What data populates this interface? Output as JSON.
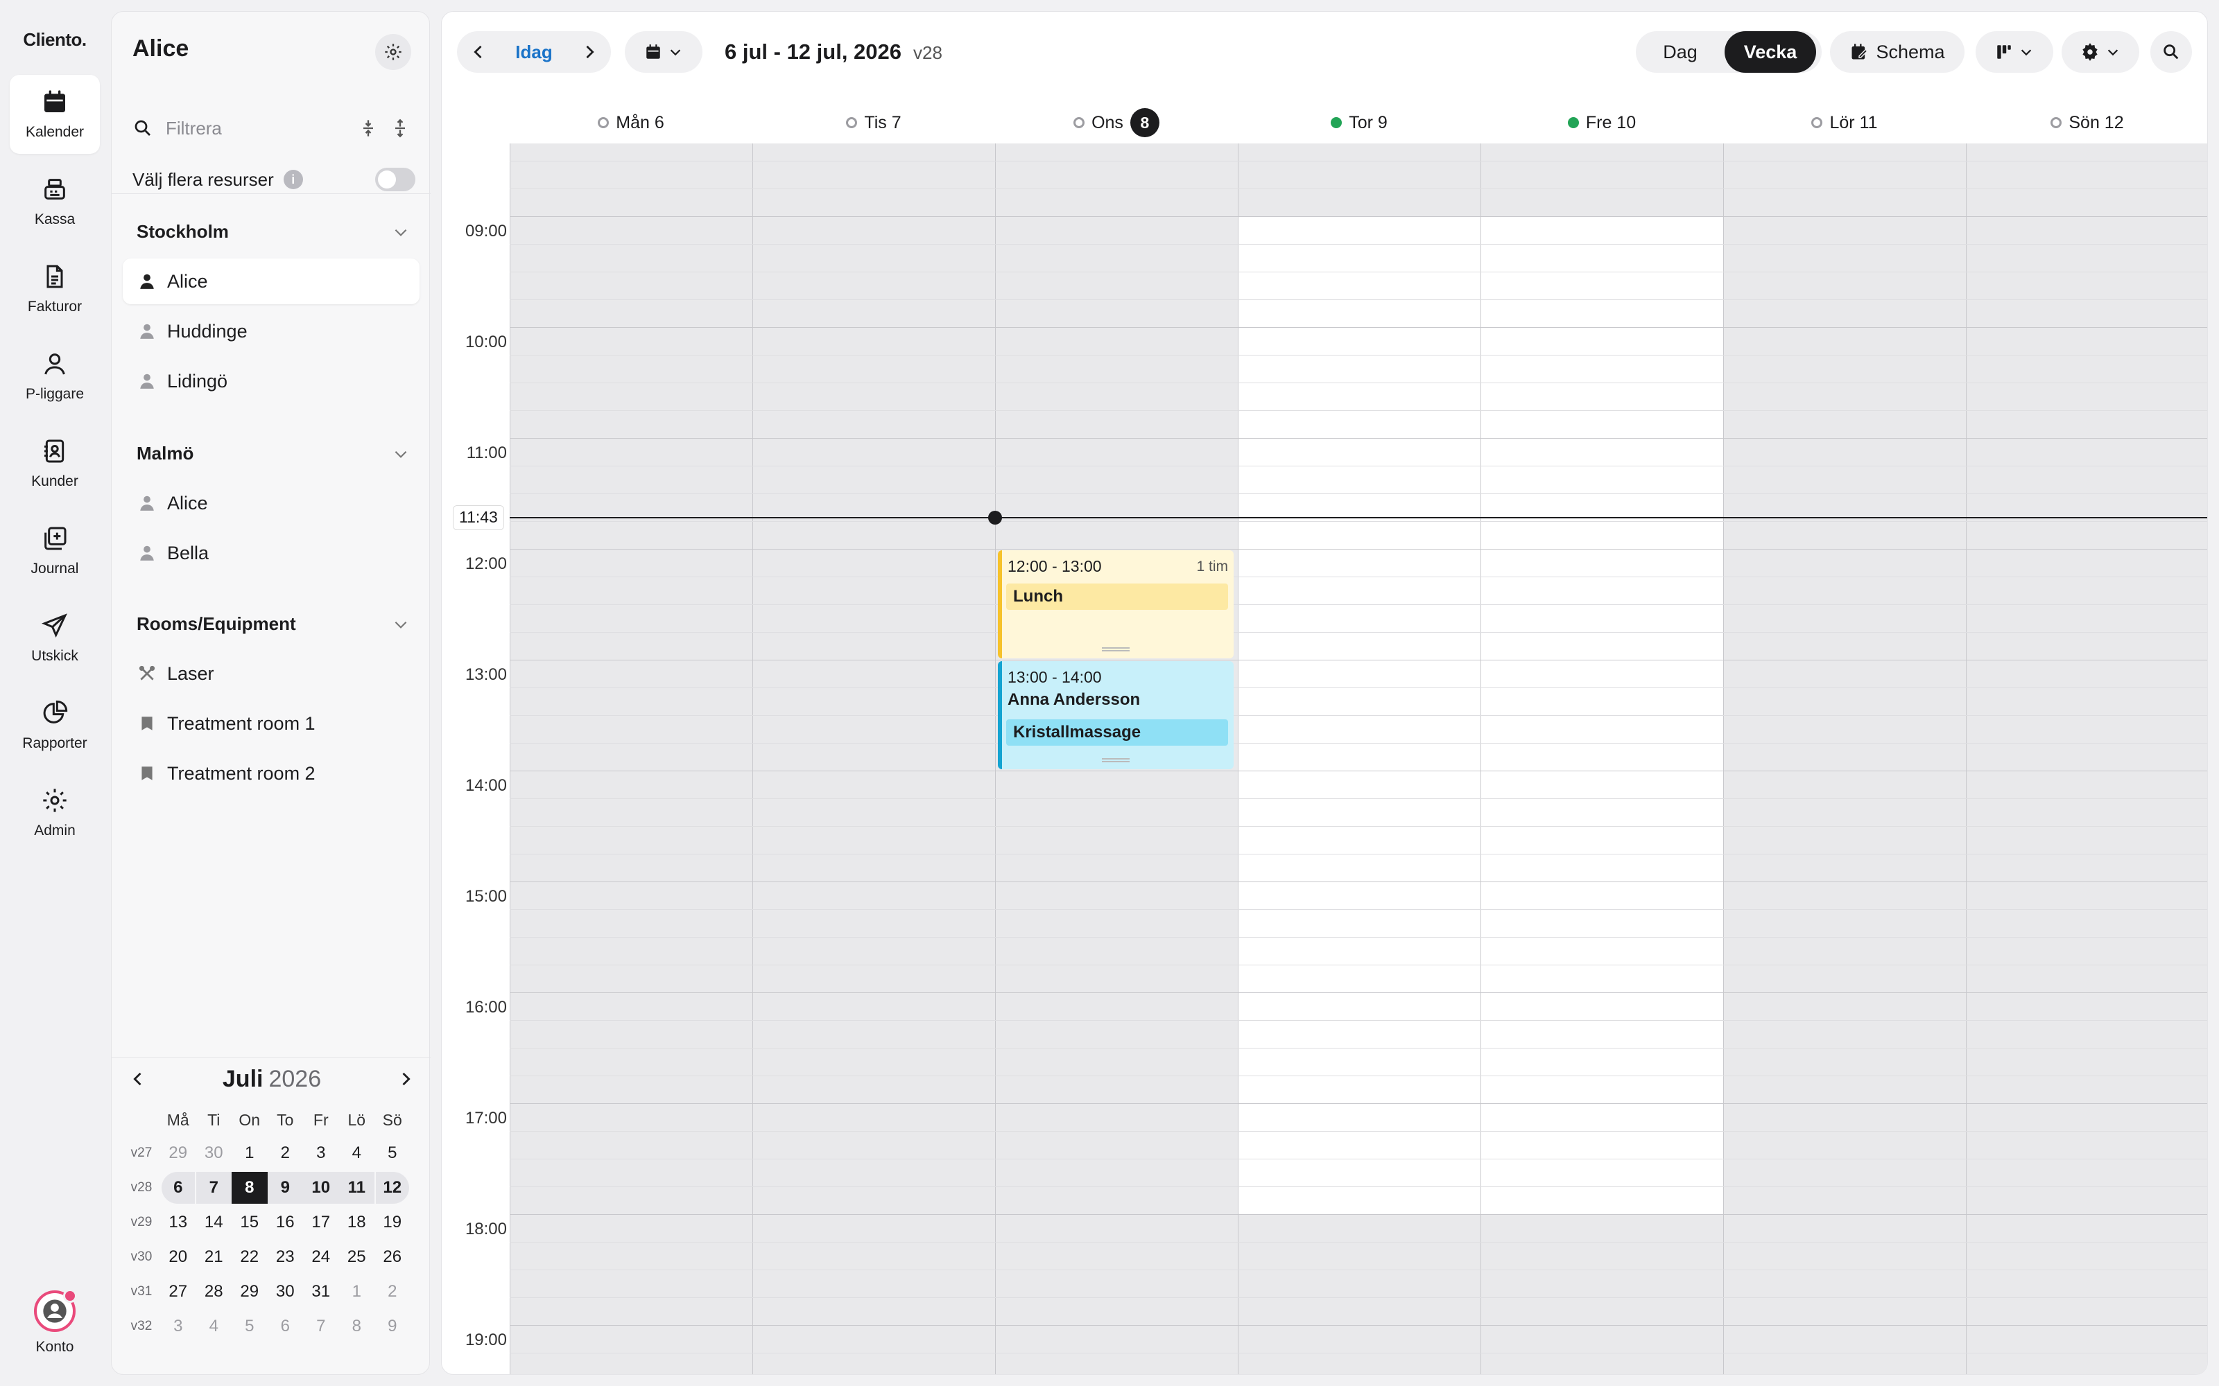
{
  "app": {
    "logo": "Cliento."
  },
  "rail": {
    "items": [
      {
        "label": "Kalender",
        "icon": "calendar-icon",
        "active": true
      },
      {
        "label": "Kassa",
        "icon": "register-icon"
      },
      {
        "label": "Fakturor",
        "icon": "invoice-icon"
      },
      {
        "label": "P-liggare",
        "icon": "person-icon"
      },
      {
        "label": "Kunder",
        "icon": "contacts-icon"
      },
      {
        "label": "Journal",
        "icon": "journal-icon"
      },
      {
        "label": "Utskick",
        "icon": "send-icon"
      },
      {
        "label": "Rapporter",
        "icon": "reports-icon"
      },
      {
        "label": "Admin",
        "icon": "gear-icon"
      }
    ],
    "account_label": "Konto"
  },
  "sidebar": {
    "title": "Alice",
    "filter_placeholder": "Filtrera",
    "multi_label": "Välj flera resurser",
    "groups": [
      {
        "name": "Stockholm",
        "items": [
          {
            "label": "Alice",
            "icon": "person-icon",
            "active": true
          },
          {
            "label": "Huddinge",
            "icon": "person-icon"
          },
          {
            "label": "Lidingö",
            "icon": "person-icon"
          }
        ]
      },
      {
        "name": "Malmö",
        "items": [
          {
            "label": "Alice",
            "icon": "person-icon"
          },
          {
            "label": "Bella",
            "icon": "person-icon"
          }
        ]
      },
      {
        "name": "Rooms/Equipment",
        "items": [
          {
            "label": "Laser",
            "icon": "tools-icon"
          },
          {
            "label": "Treatment room 1",
            "icon": "bookmark-icon"
          },
          {
            "label": "Treatment room 2",
            "icon": "bookmark-icon"
          }
        ]
      }
    ]
  },
  "mini_calendar": {
    "month": "Juli",
    "year": "2026",
    "weekdays": [
      "Må",
      "Ti",
      "On",
      "To",
      "Fr",
      "Lö",
      "Sö"
    ],
    "weeks": [
      {
        "wk": "v27",
        "days": [
          "29",
          "30",
          "1",
          "2",
          "3",
          "4",
          "5"
        ]
      },
      {
        "wk": "v28",
        "days": [
          "6",
          "7",
          "8",
          "9",
          "10",
          "11",
          "12"
        ]
      },
      {
        "wk": "v29",
        "days": [
          "13",
          "14",
          "15",
          "16",
          "17",
          "18",
          "19"
        ]
      },
      {
        "wk": "v30",
        "days": [
          "20",
          "21",
          "22",
          "23",
          "24",
          "25",
          "26"
        ]
      },
      {
        "wk": "v31",
        "days": [
          "27",
          "28",
          "29",
          "30",
          "31",
          "1",
          "2"
        ]
      },
      {
        "wk": "v32",
        "days": [
          "3",
          "4",
          "5",
          "6",
          "7",
          "8",
          "9"
        ]
      }
    ],
    "today": "8"
  },
  "toolbar": {
    "today_label": "Idag",
    "date_range": "6 jul - 12 jul, 2026",
    "week_label": "v28",
    "view_day": "Dag",
    "view_week": "Vecka",
    "schedule_label": "Schema"
  },
  "days": [
    {
      "label": "Mån 6",
      "status": "closed"
    },
    {
      "label": "Tis 7",
      "status": "closed"
    },
    {
      "label": "Ons",
      "num": "8",
      "status": "closed",
      "today": true
    },
    {
      "label": "Tor 9",
      "status": "open"
    },
    {
      "label": "Fre 10",
      "status": "open"
    },
    {
      "label": "Lör 11",
      "status": "closed"
    },
    {
      "label": "Sön 12",
      "status": "closed"
    }
  ],
  "hours": [
    "09:00",
    "10:00",
    "11:00",
    "12:00",
    "13:00",
    "14:00",
    "15:00",
    "16:00",
    "17:00",
    "18:00",
    "19:00"
  ],
  "now_label": "11:43",
  "events": [
    {
      "time": "12:00 - 13:00",
      "duration": "1 tim",
      "name": "",
      "tag": "Lunch",
      "color": "#f6c22b",
      "bg": "#fff7d9",
      "tag_bg": "#fde9a3"
    },
    {
      "time": "13:00 - 14:00",
      "duration": "",
      "name": "Anna Andersson",
      "tag": "Kristallmassage",
      "color": "#14a3d1",
      "bg": "#c8f0fa",
      "tag_bg": "#8fe0f5"
    }
  ]
}
